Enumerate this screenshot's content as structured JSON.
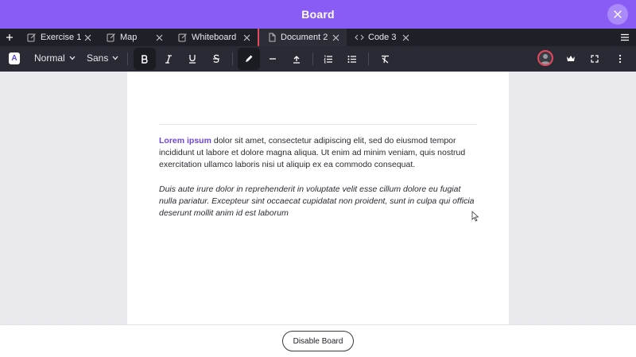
{
  "window": {
    "title": "Board"
  },
  "tabs": [
    {
      "label": "Exercise 1",
      "icon": "edit-icon"
    },
    {
      "label": "Map",
      "icon": "edit-icon"
    },
    {
      "label": "Whiteboard",
      "icon": "edit-icon"
    },
    {
      "label": "Document 2",
      "icon": "document-icon",
      "active": true
    },
    {
      "label": "Code 3",
      "icon": "code-icon"
    }
  ],
  "toolbar": {
    "logo_letter": "A",
    "paragraph_style": "Normal",
    "font_family": "Sans"
  },
  "document": {
    "p1_lead": "Lorem ipsum",
    "p1_rest": " dolor sit amet, consectetur adipiscing elit, sed do eiusmod tempor incididunt ut labore et dolore magna aliqua. Ut enim ad minim veniam, quis nostrud exercitation ullamco laboris nisi ut aliquip ex ea commodo consequat.",
    "p2": "Duis aute irure dolor in reprehenderit in voluptate velit esse cillum dolore eu fugiat nulla pariatur. Excepteur sint occaecat cupidatat non proident, sunt in culpa qui officia deserunt mollit anim id est laborum"
  },
  "footer": {
    "disable_label": "Disable Board"
  },
  "colors": {
    "accent": "#8a5cf6",
    "active_tab_border": "#e4485c",
    "link_text": "#6d45d8"
  }
}
